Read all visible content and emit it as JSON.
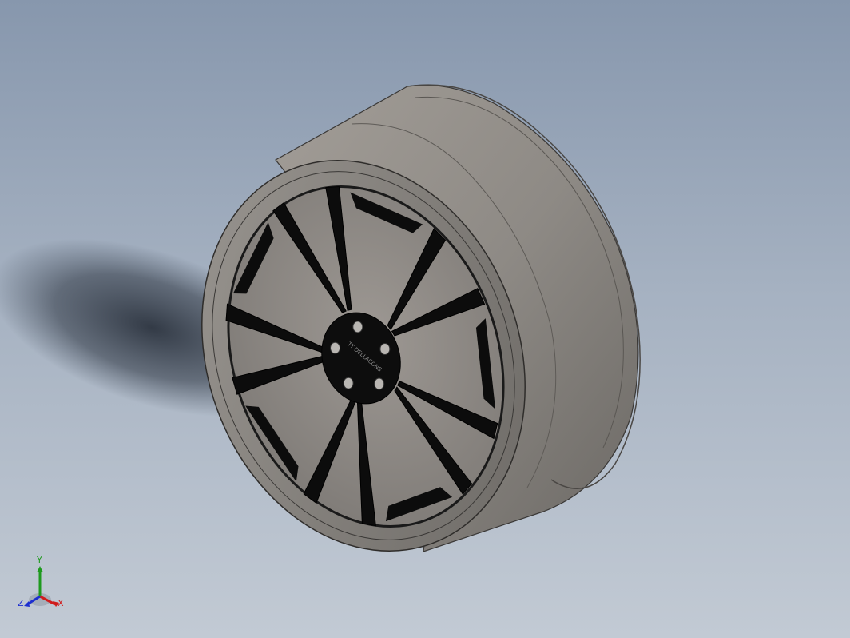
{
  "viewport": {
    "background_top": "#8797ad",
    "background_bottom": "#c2cad4"
  },
  "model": {
    "name": "wheel-rim",
    "rim_color": "#8c8985",
    "spoke_color": "#0c0c0c",
    "hub_logo_text": "TT DELLACONS"
  },
  "triad": {
    "x_label": "X",
    "y_label": "Y",
    "z_label": "Z",
    "x_color": "#d01c1c",
    "y_color": "#1e9a1e",
    "z_color": "#1c2ed0"
  }
}
